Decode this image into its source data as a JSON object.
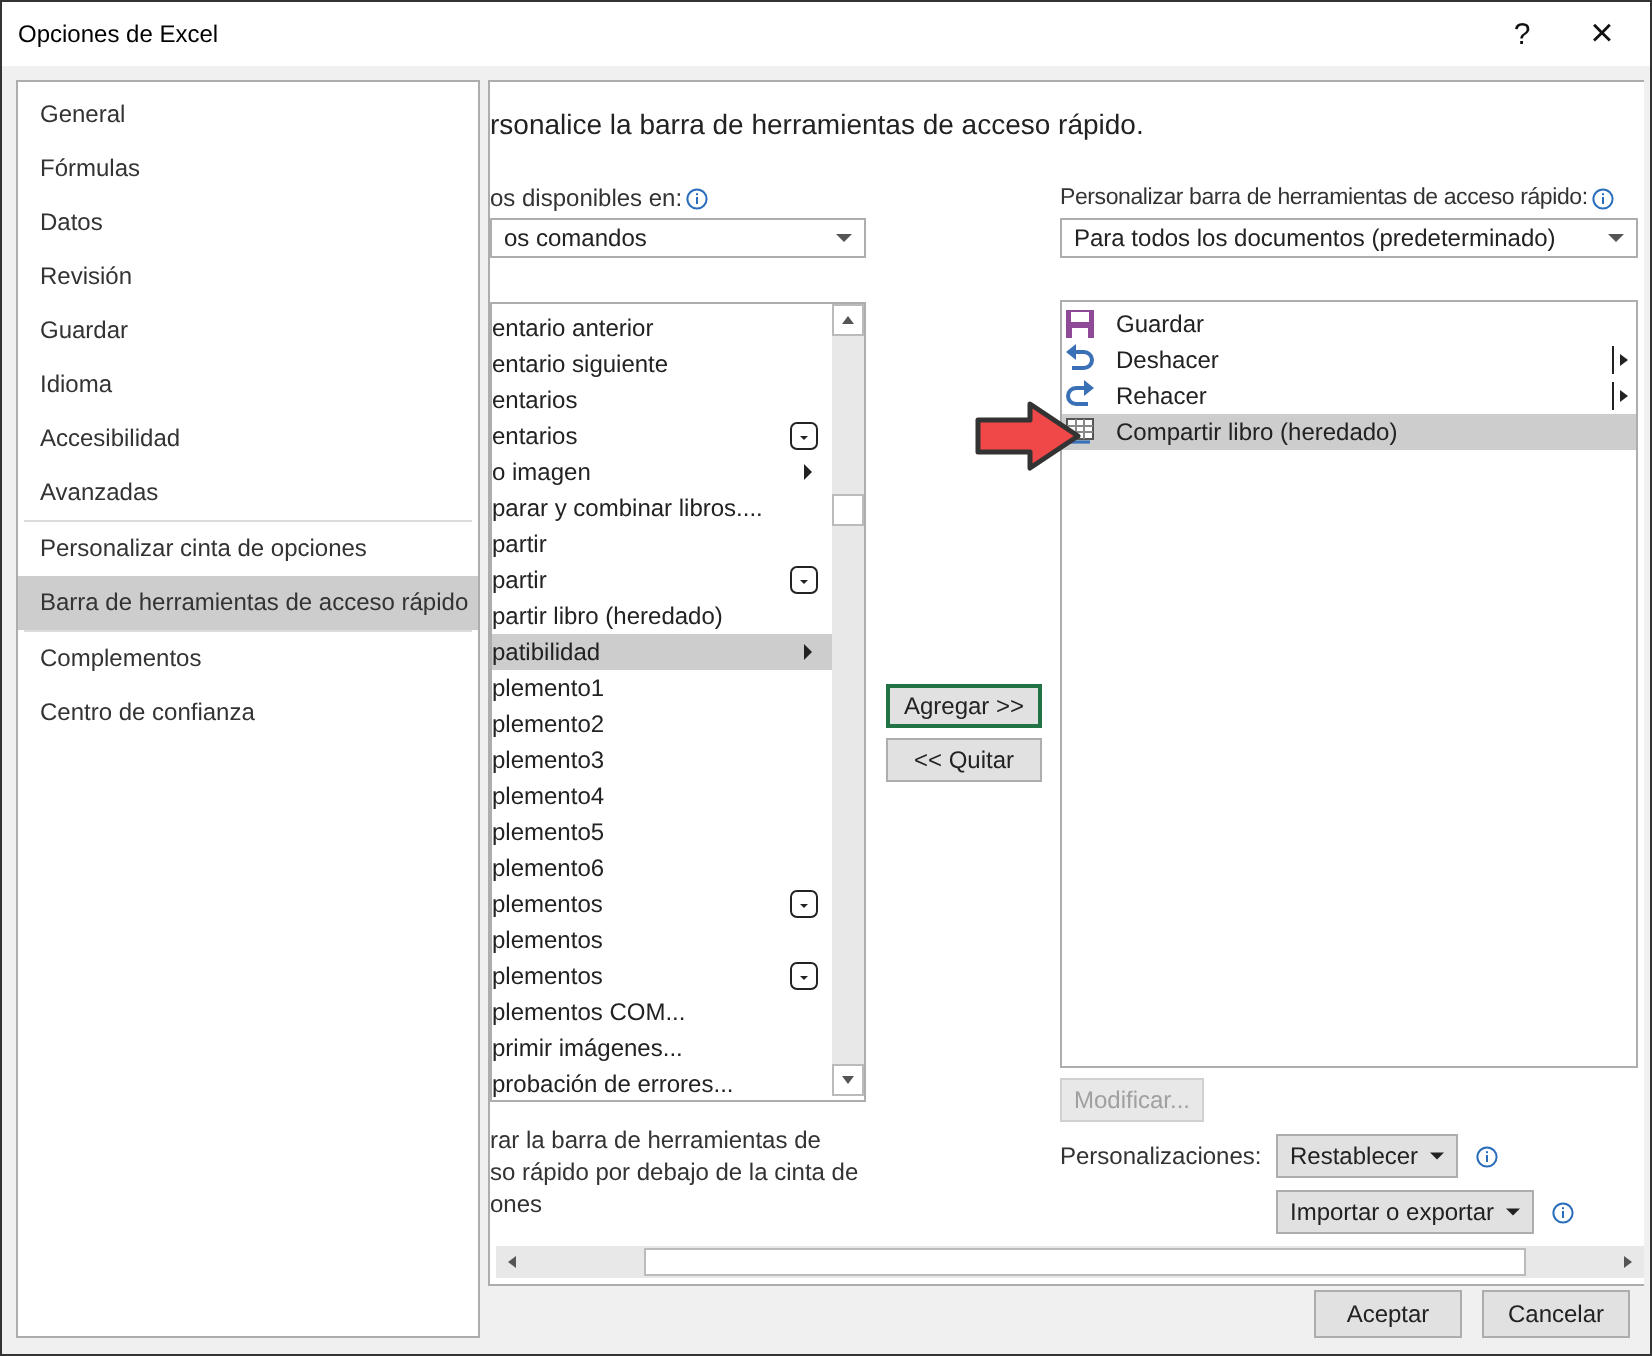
{
  "window": {
    "title": "Opciones de Excel",
    "help": "?",
    "close": "×"
  },
  "sidebar": {
    "items": [
      {
        "label": "General",
        "selected": false,
        "group_end": false
      },
      {
        "label": "Fórmulas",
        "selected": false,
        "group_end": false
      },
      {
        "label": "Datos",
        "selected": false,
        "group_end": false
      },
      {
        "label": "Revisión",
        "selected": false,
        "group_end": false
      },
      {
        "label": "Guardar",
        "selected": false,
        "group_end": false
      },
      {
        "label": "Idioma",
        "selected": false,
        "group_end": false
      },
      {
        "label": "Accesibilidad",
        "selected": false,
        "group_end": false
      },
      {
        "label": "Avanzadas",
        "selected": false,
        "group_end": true
      },
      {
        "label": "Personalizar cinta de opciones",
        "selected": false,
        "group_end": false
      },
      {
        "label": "Barra de herramientas de acceso rápido",
        "selected": true,
        "group_end": true
      },
      {
        "label": "Complementos",
        "selected": false,
        "group_end": false
      },
      {
        "label": "Centro de confianza",
        "selected": false,
        "group_end": false
      }
    ]
  },
  "heading": "rsonalice la barra de herramientas de acceso rápido.",
  "commands": {
    "label": "os disponibles en:",
    "dropdown": "os comandos",
    "items": [
      {
        "label": "entario anterior",
        "kind": "plain",
        "selected": false
      },
      {
        "label": "entario siguiente",
        "kind": "plain",
        "selected": false
      },
      {
        "label": "entarios",
        "kind": "plain",
        "selected": false
      },
      {
        "label": "entarios",
        "kind": "gallery",
        "selected": false
      },
      {
        "label": "o imagen",
        "kind": "submenu",
        "selected": false
      },
      {
        "label": "parar y combinar libros....",
        "kind": "plain",
        "selected": false
      },
      {
        "label": "partir",
        "kind": "plain",
        "selected": false
      },
      {
        "label": "partir",
        "kind": "gallery",
        "selected": false
      },
      {
        "label": "partir libro (heredado)",
        "kind": "plain",
        "selected": false
      },
      {
        "label": "patibilidad",
        "kind": "submenu",
        "selected": true
      },
      {
        "label": "plemento1",
        "kind": "plain",
        "selected": false
      },
      {
        "label": "plemento2",
        "kind": "plain",
        "selected": false
      },
      {
        "label": "plemento3",
        "kind": "plain",
        "selected": false
      },
      {
        "label": "plemento4",
        "kind": "plain",
        "selected": false
      },
      {
        "label": "plemento5",
        "kind": "plain",
        "selected": false
      },
      {
        "label": "plemento6",
        "kind": "plain",
        "selected": false
      },
      {
        "label": "plementos",
        "kind": "gallery",
        "selected": false
      },
      {
        "label": "plementos",
        "kind": "plain",
        "selected": false
      },
      {
        "label": "plementos",
        "kind": "gallery",
        "selected": false
      },
      {
        "label": "plementos COM...",
        "kind": "plain",
        "selected": false
      },
      {
        "label": "primir imágenes...",
        "kind": "plain",
        "selected": false
      },
      {
        "label": "probación de errores...",
        "kind": "plain",
        "selected": false
      }
    ],
    "below_ribbon_text": "rar la barra de herramientas de\nso rápido por debajo de la cinta de\nones"
  },
  "add_button": "Agregar >>",
  "remove_button": "<< Quitar",
  "toolbar": {
    "label": "Personalizar barra de herramientas de acceso rápido:",
    "dropdown": "Para todos los documentos (predeterminado)",
    "items": [
      {
        "label": "Guardar",
        "kind": "save",
        "submenu": false,
        "selected": false
      },
      {
        "label": "Deshacer",
        "kind": "undo",
        "submenu": true,
        "selected": false
      },
      {
        "label": "Rehacer",
        "kind": "redo",
        "submenu": true,
        "selected": false
      },
      {
        "label": "Compartir libro (heredado)",
        "kind": "share",
        "submenu": false,
        "selected": true
      }
    ],
    "modify_button": {
      "label": "Modificar...",
      "disabled": true
    },
    "customizations_label": "Personalizaciones:",
    "reset_button": "Restablecer",
    "import_export_button": "Importar o exportar"
  },
  "buttons": [
    "Aceptar",
    "Cancelar"
  ]
}
